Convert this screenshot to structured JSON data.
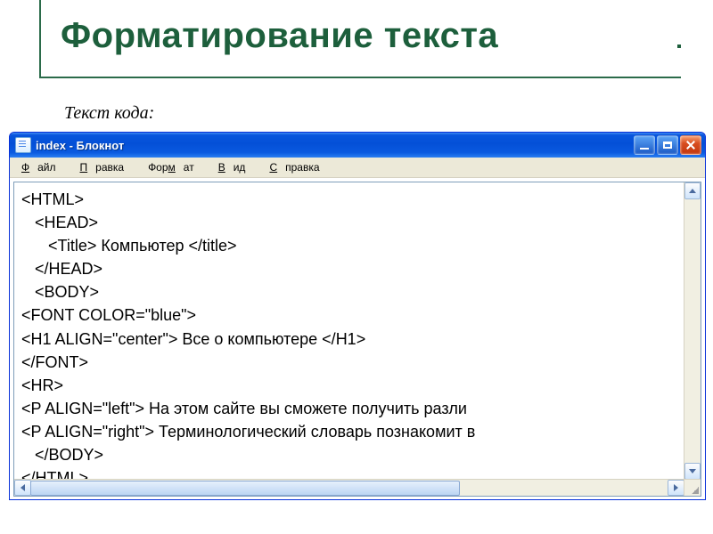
{
  "slide": {
    "title": "Форматирование текста",
    "code_label": "Текст кода:"
  },
  "window": {
    "caption": "index - Блокнот",
    "menu": {
      "file": "Файл",
      "edit": "Правка",
      "format": "Формат",
      "view": "Вид",
      "help": "Справка"
    }
  },
  "code_lines": [
    "<HTML>",
    "   <HEAD>",
    "      <Title> Компьютер </title>",
    "   </HEAD>",
    "   <BODY>",
    "<FONT COLOR=\"blue\">",
    "<H1 ALIGN=\"center\"> Все о компьютере </H1>",
    "</FONT>",
    "<HR>",
    "<P ALIGN=\"left\"> На этом сайте вы сможете получить разли",
    "<P ALIGN=\"right\"> Терминологический словарь познакомит в",
    "   </BODY>",
    "</HTML>"
  ]
}
